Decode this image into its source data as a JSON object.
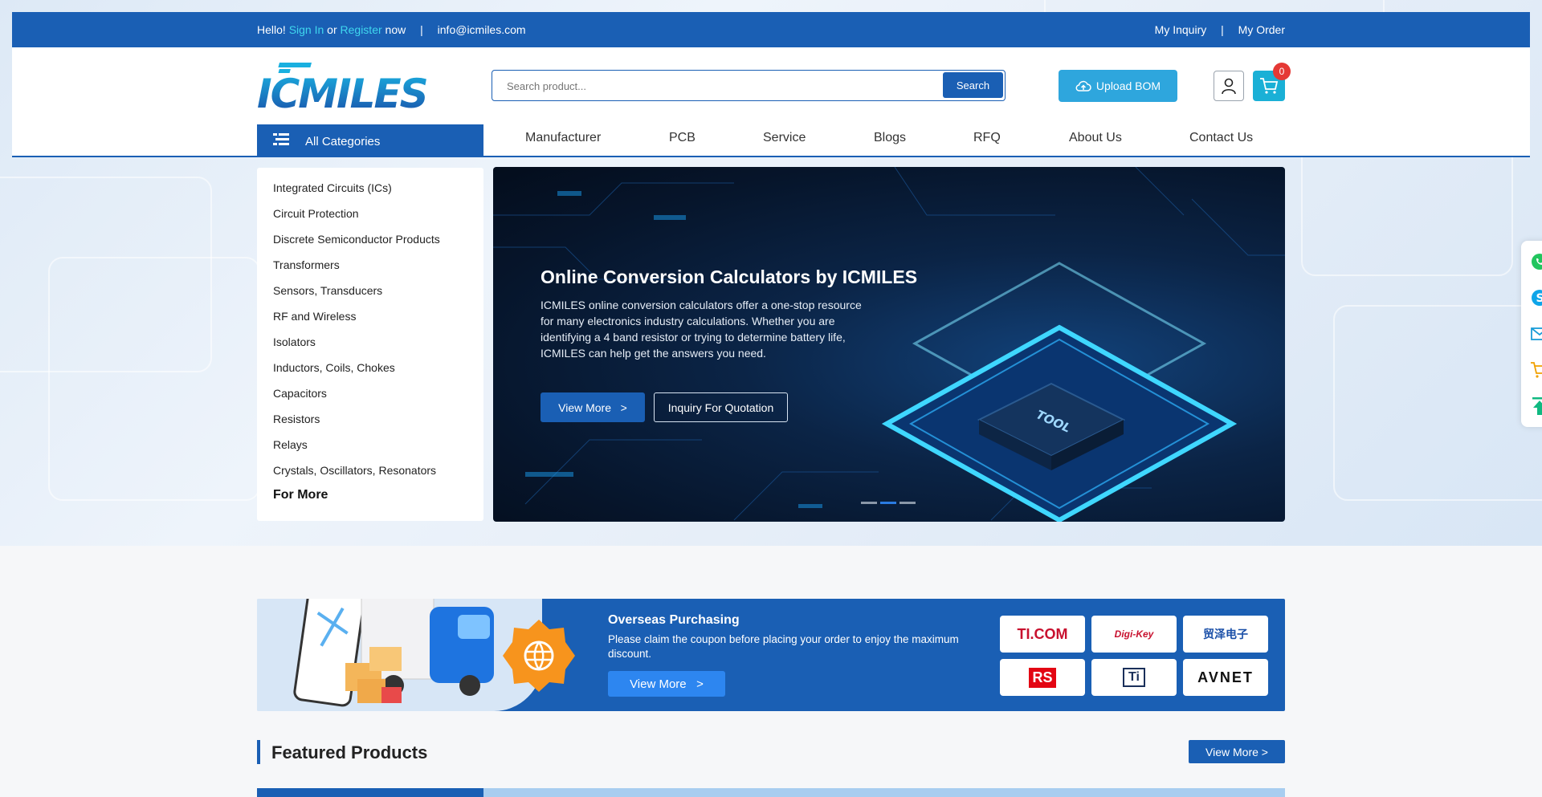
{
  "colors": {
    "primary": "#1a5fb4",
    "accent_link": "#3fd7ee",
    "upload_button": "#2ea6dd",
    "cart": "#1ab0d6",
    "badge": "#e53935"
  },
  "topbar": {
    "hello": "Hello!",
    "sign_in": "Sign In",
    "or": "or",
    "register": "Register",
    "now": "now",
    "separator": "|",
    "email": "info@icmiles.com",
    "my_inquiry": "My Inquiry",
    "my_order": "My Order"
  },
  "header": {
    "logo_text": "ICMILES",
    "search_placeholder": "Search product...",
    "search_button": "Search",
    "upload_bom": "Upload BOM",
    "cart_count": "0"
  },
  "nav": {
    "all_categories": "All Categories",
    "items": [
      "Manufacturer",
      "PCB",
      "Service",
      "Blogs",
      "RFQ",
      "About Us",
      "Contact Us"
    ]
  },
  "categories": {
    "items": [
      "Integrated Circuits (ICs)",
      "Circuit Protection",
      "Discrete Semiconductor Products",
      "Transformers",
      "Sensors, Transducers",
      "RF and Wireless",
      "Isolators",
      "Inductors, Coils, Chokes",
      "Capacitors",
      "Resistors",
      "Relays",
      "Crystals, Oscillators, Resonators"
    ],
    "more": "For More"
  },
  "banner": {
    "title": "Online Conversion Calculators by ICMILES",
    "description": "ICMILES online conversion calculators offer a one-stop resource for many electronics industry calculations. Whether you are identifying a 4 band resistor or trying to determine battery life, ICMILES can help get the answers you need.",
    "view_more": "View More   >",
    "inquiry": "Inquiry For Quotation",
    "chip_label": "TOOL",
    "active_slide": 2,
    "slide_count": 3
  },
  "side_float": {
    "icons": [
      "whatsapp-icon",
      "skype-icon",
      "mail-icon",
      "cart-icon",
      "back-to-top-icon"
    ]
  },
  "promo": {
    "title": "Overseas Purchasing",
    "description": "Please claim the coupon before placing your order to enjoy the maximum discount.",
    "button": "View More   >",
    "brands": [
      "TI.COM",
      "Digi-Key",
      "贸泽电子",
      "RS",
      "Ti",
      "AVNET"
    ]
  },
  "featured": {
    "title": "Featured Products",
    "view_more": "View More >"
  }
}
